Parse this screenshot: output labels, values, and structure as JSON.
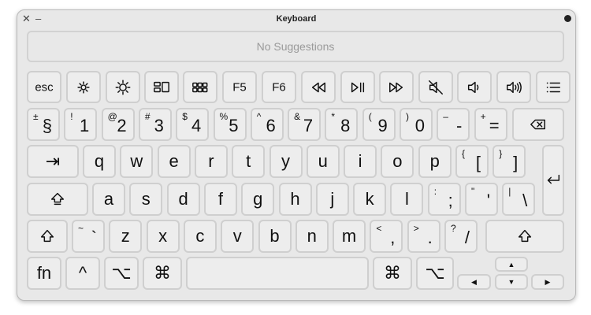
{
  "window": {
    "title": "Keyboard"
  },
  "suggestions": {
    "text": "No Suggestions"
  },
  "function_row": [
    {
      "name": "esc-key",
      "label": "esc"
    },
    {
      "name": "brightness-down-key",
      "icon": "brightness-down-icon"
    },
    {
      "name": "brightness-up-key",
      "icon": "brightness-up-icon"
    },
    {
      "name": "mission-control-key",
      "icon": "mission-control-icon"
    },
    {
      "name": "launchpad-key",
      "icon": "launchpad-icon"
    },
    {
      "name": "f5-key",
      "label": "F5"
    },
    {
      "name": "f6-key",
      "label": "F6"
    },
    {
      "name": "rewind-key",
      "icon": "rewind-icon"
    },
    {
      "name": "play-pause-key",
      "icon": "play-pause-icon"
    },
    {
      "name": "fast-forward-key",
      "icon": "fast-forward-icon"
    },
    {
      "name": "mute-key",
      "icon": "mute-icon"
    },
    {
      "name": "volume-down-key",
      "icon": "volume-down-icon"
    },
    {
      "name": "volume-up-key",
      "icon": "volume-up-icon"
    },
    {
      "name": "list-key",
      "icon": "list-icon"
    }
  ],
  "number_row": [
    {
      "sub": "±",
      "main": "§"
    },
    {
      "sub": "!",
      "main": "1"
    },
    {
      "sub": "@",
      "main": "2"
    },
    {
      "sub": "#",
      "main": "3"
    },
    {
      "sub": "$",
      "main": "4"
    },
    {
      "sub": "%",
      "main": "5"
    },
    {
      "sub": "^",
      "main": "6"
    },
    {
      "sub": "&",
      "main": "7"
    },
    {
      "sub": "*",
      "main": "8"
    },
    {
      "sub": "(",
      "main": "9"
    },
    {
      "sub": ")",
      "main": "0"
    },
    {
      "sub": "–",
      "main": "-"
    },
    {
      "sub": "+",
      "main": "="
    }
  ],
  "qwerty_row": [
    {
      "main": "q"
    },
    {
      "main": "w"
    },
    {
      "main": "e"
    },
    {
      "main": "r"
    },
    {
      "main": "t"
    },
    {
      "main": "y"
    },
    {
      "main": "u"
    },
    {
      "main": "i"
    },
    {
      "main": "o"
    },
    {
      "main": "p"
    },
    {
      "sub": "{",
      "main": "["
    },
    {
      "sub": "}",
      "main": "]"
    }
  ],
  "home_row": [
    {
      "main": "a"
    },
    {
      "main": "s"
    },
    {
      "main": "d"
    },
    {
      "main": "f"
    },
    {
      "main": "g"
    },
    {
      "main": "h"
    },
    {
      "main": "j"
    },
    {
      "main": "k"
    },
    {
      "main": "l"
    },
    {
      "sub": ":",
      "main": ";"
    },
    {
      "sub": "\"",
      "main": "'"
    },
    {
      "sub": "|",
      "main": "\\"
    }
  ],
  "bottom_row": [
    {
      "sub": "~",
      "main": "`"
    },
    {
      "main": "z"
    },
    {
      "main": "x"
    },
    {
      "main": "c"
    },
    {
      "main": "v"
    },
    {
      "main": "b"
    },
    {
      "main": "n"
    },
    {
      "main": "m"
    },
    {
      "sub": "<",
      "main": ","
    },
    {
      "sub": ">",
      "main": "."
    },
    {
      "sub": "?",
      "main": "/"
    }
  ],
  "modifiers": {
    "fn": "fn",
    "control": "^",
    "option": "⌥",
    "command": "⌘",
    "command_right": "⌘",
    "option_right": "⌥",
    "tab": "⇥",
    "arrow_up": "▲",
    "arrow_left": "◀",
    "arrow_down": "▼",
    "arrow_right": "▶"
  },
  "colors": {
    "window_bg": "#e8e8e8",
    "key_bg": "#ededed",
    "key_border": "#cfcfcf",
    "placeholder": "#9a9a9a"
  }
}
